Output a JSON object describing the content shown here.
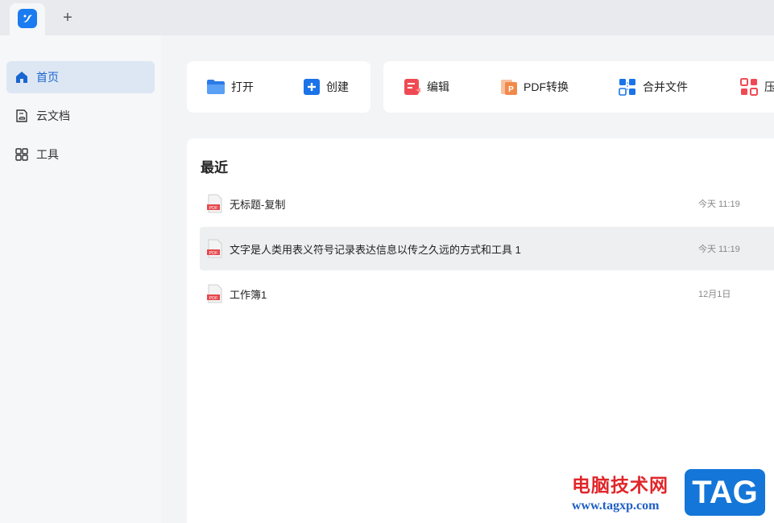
{
  "tabbar": {
    "new_tab": "+",
    "logo_icon": "app-logo-icon"
  },
  "sidebar": {
    "items": [
      {
        "label": "首页",
        "icon": "home-icon"
      },
      {
        "label": "云文档",
        "icon": "cloud-doc-icon"
      },
      {
        "label": "工具",
        "icon": "grid-icon"
      }
    ]
  },
  "quick_actions": {
    "open": "打开",
    "create": "创建",
    "edit": "编辑",
    "pdf_convert": "PDF转换",
    "merge": "合并文件",
    "compress": "压"
  },
  "recent": {
    "title": "最近",
    "files": [
      {
        "name": "无标题-复制",
        "time": "今天 11:19"
      },
      {
        "name": "文字是人类用表义符号记录表达信息以传之久远的方式和工具 1",
        "time": "今天 11:19"
      },
      {
        "name": "工作簿1",
        "time": "12月1日"
      }
    ]
  },
  "watermark": {
    "title": "电脑技术网",
    "url": "www.tagxp.com",
    "tag": "TAG"
  },
  "colors": {
    "accent": "#1a66d0",
    "pdf_red": "#e5484d",
    "active_bg": "#dde6f3"
  }
}
